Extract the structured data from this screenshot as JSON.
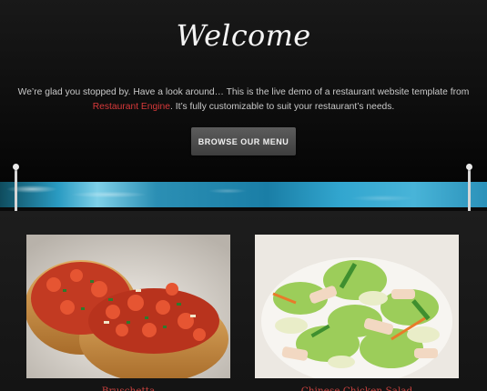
{
  "hero": {
    "title": "Welcome",
    "intro_line1": "We’re glad you stopped by.  Have a look around…  This is the live demo of a restaurant website template from",
    "intro_link": "Restaurant Engine",
    "intro_line2_rest": ".  It’s fully customizable to suit your restaurant’s needs.",
    "menu_button_label": "BROWSE OUR MENU"
  },
  "featured": [
    {
      "caption": "Bruschetta",
      "image": "bruschetta-photo"
    },
    {
      "caption": "Chinese Chicken Salad",
      "image": "chicken-salad-photo"
    }
  ],
  "colors": {
    "link": "#d8393a",
    "button": "#4a4a4a",
    "ocean": "#2a9bc2"
  }
}
